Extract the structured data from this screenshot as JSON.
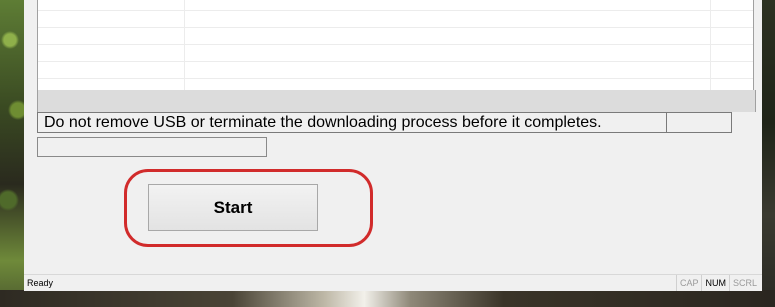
{
  "app": {
    "message": "Do not remove USB or terminate the downloading process before it completes.",
    "progress_percent": 0,
    "start_button_label": "Start"
  },
  "status_bar": {
    "status_text": "Ready",
    "indicators": [
      {
        "label": "CAP",
        "active": false
      },
      {
        "label": "NUM",
        "active": true
      },
      {
        "label": "SCRL",
        "active": false
      }
    ]
  },
  "annotation": {
    "highlight_color": "#d12b2b"
  }
}
